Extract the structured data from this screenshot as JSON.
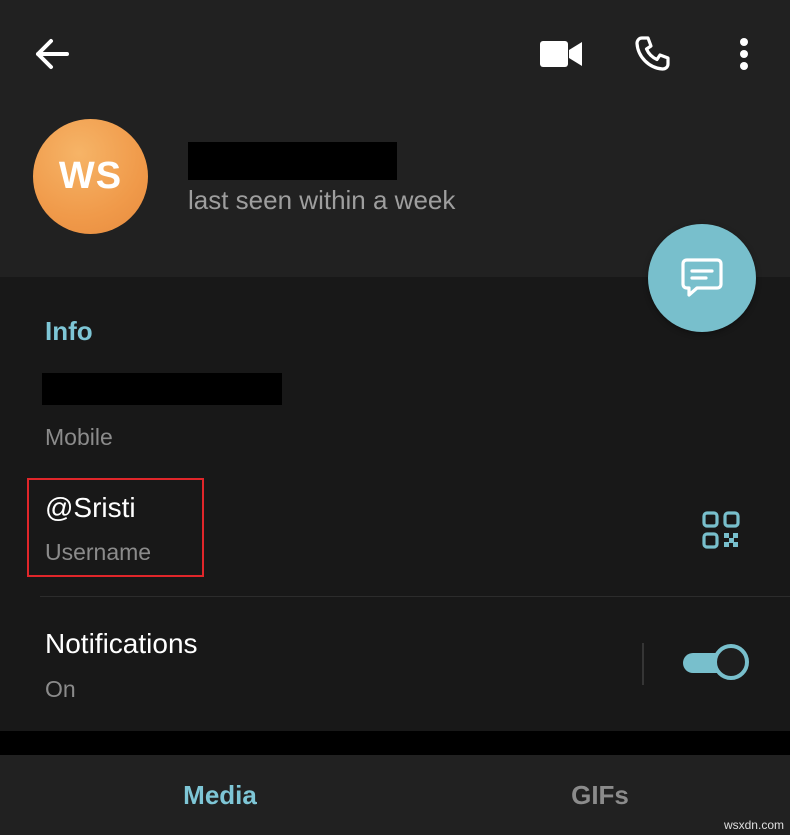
{
  "header": {
    "icons": {
      "back": "back-arrow-icon",
      "video": "video-camera-icon",
      "call": "phone-icon",
      "menu": "more-vertical-icon"
    },
    "avatar_initials": "WS",
    "status": "last seen within a week"
  },
  "fab": {
    "icon": "message-icon"
  },
  "info": {
    "title": "Info",
    "phone_label": "Mobile",
    "username": "@Sristi",
    "username_label": "Username",
    "qr_icon": "qr-code-icon",
    "notifications": "Notifications",
    "notifications_status": "On",
    "notifications_enabled": true
  },
  "tabs": [
    {
      "label": "Media",
      "active": true
    },
    {
      "label": "GIFs",
      "active": false
    }
  ],
  "watermark": "wsxdn.com",
  "colors": {
    "accent": "#78bfcc",
    "header_bg": "#212121",
    "section_bg": "#181818",
    "highlight_border": "#e0262a",
    "avatar": "#f09a4a"
  }
}
